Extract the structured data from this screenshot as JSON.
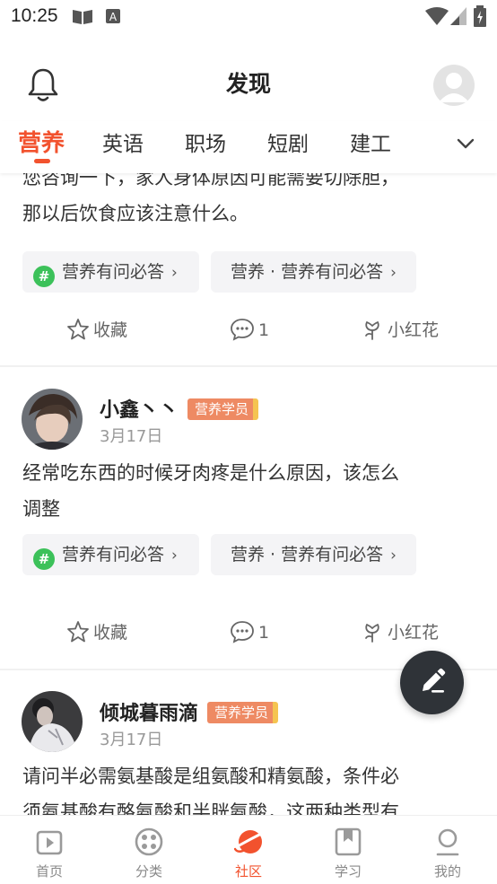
{
  "status_bar": {
    "time": "10:25"
  },
  "header": {
    "title": "发现"
  },
  "tabs": [
    {
      "label": "营养",
      "active": true
    },
    {
      "label": "英语"
    },
    {
      "label": "职场"
    },
    {
      "label": "短剧"
    },
    {
      "label": "建工"
    }
  ],
  "posts": [
    {
      "text_partial_top": "您咨询一下，家人身体原因可能需要切除胆，",
      "text_line2": "那以后饮食应该注意什么。",
      "topic_chip": "营养有问必答",
      "category_chip": "营养 · 营养有问必答",
      "actions": {
        "favorite": "收藏",
        "comments": "1",
        "flower": "小红花"
      }
    },
    {
      "username": "小鑫丶丶",
      "badge": "营养学员",
      "date": "3月17日",
      "text_line1": "经常吃东西的时候牙肉疼是什么原因，该怎么",
      "text_line2": "调整",
      "topic_chip": "营养有问必答",
      "category_chip": "营养 · 营养有问必答",
      "actions": {
        "favorite": "收藏",
        "comments": "1",
        "flower": "小红花"
      }
    },
    {
      "username": "倾城暮雨滴",
      "badge": "营养学员",
      "date": "3月17日",
      "text_line1": "请问半必需氨基酸是组氨酸和精氨酸，条件必",
      "text_line2_partial": "须氨基酸有酪氨酸和半胱氨酸，这两种类型有"
    }
  ],
  "bottom_nav": [
    {
      "label": "首页"
    },
    {
      "label": "分类"
    },
    {
      "label": "社区",
      "active": true
    },
    {
      "label": "学习"
    },
    {
      "label": "我的"
    }
  ],
  "colors": {
    "accent": "#f2522e",
    "badge": "#ee8a63",
    "topic_green": "#3cc15a"
  }
}
